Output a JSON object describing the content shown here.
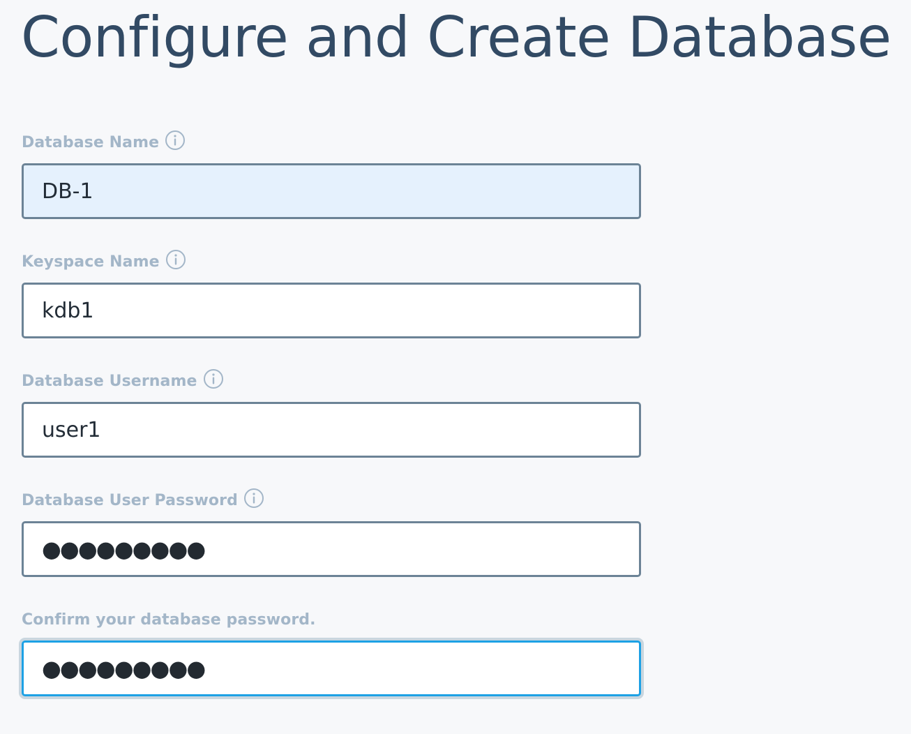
{
  "page": {
    "title": "Configure and Create Database"
  },
  "form": {
    "database_name": {
      "label": "Database Name",
      "value": "DB-1",
      "info_icon": "info-circle-icon"
    },
    "keyspace_name": {
      "label": "Keyspace Name",
      "value": "kdb1",
      "info_icon": "info-circle-icon"
    },
    "database_username": {
      "label": "Database Username",
      "value": "user1",
      "info_icon": "info-circle-icon"
    },
    "database_password": {
      "label": "Database User Password",
      "masked_value": "●●●●●●●●●",
      "info_icon": "info-circle-icon"
    },
    "confirm_password": {
      "label": "Confirm your database password.",
      "masked_value": "●●●●●●●●●"
    }
  },
  "colors": {
    "title": "#324a64",
    "label": "#a3b6c8",
    "input_border": "#6c8396",
    "focus_border": "#1da1e5",
    "autofill_background": "#e5f1fd",
    "page_background": "#f7f8fa"
  }
}
